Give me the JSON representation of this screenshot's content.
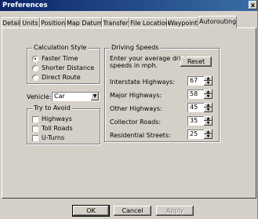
{
  "window": {
    "title": "Preferences",
    "close_glyph": "x"
  },
  "tabs": [
    "Detail",
    "Units",
    "Position",
    "Map Datum",
    "Transfer",
    "File Location",
    "Waypoint",
    "Autorouting"
  ],
  "active_tab": "Autorouting",
  "calculation_style": {
    "legend": "Calculation Style",
    "options": [
      {
        "label": "Faster Time",
        "selected": true
      },
      {
        "label": "Shorter Distance",
        "selected": false
      },
      {
        "label": "Direct Route",
        "selected": false
      }
    ]
  },
  "vehicle": {
    "label": "Vehicle:",
    "value": "Car"
  },
  "try_to_avoid": {
    "legend": "Try to Avoid",
    "options": [
      {
        "label": "Highways",
        "checked": false
      },
      {
        "label": "Toll Roads",
        "checked": false
      },
      {
        "label": "U-Turns",
        "checked": false
      }
    ]
  },
  "driving_speeds": {
    "legend": "Driving Speeds",
    "instruction_line1": "Enter your average driving",
    "instruction_line2": "speeds in mph.",
    "reset_label": "Reset",
    "rows": [
      {
        "label": "Interstate Highways:",
        "value": "67"
      },
      {
        "label": "Major Highways:",
        "value": "58"
      },
      {
        "label": "Other Highways:",
        "value": "45"
      },
      {
        "label": "Collector Roads:",
        "value": "35"
      },
      {
        "label": "Residential Streets:",
        "value": "25"
      }
    ]
  },
  "footer": {
    "ok": "OK",
    "cancel": "Cancel",
    "apply": "Apply"
  }
}
